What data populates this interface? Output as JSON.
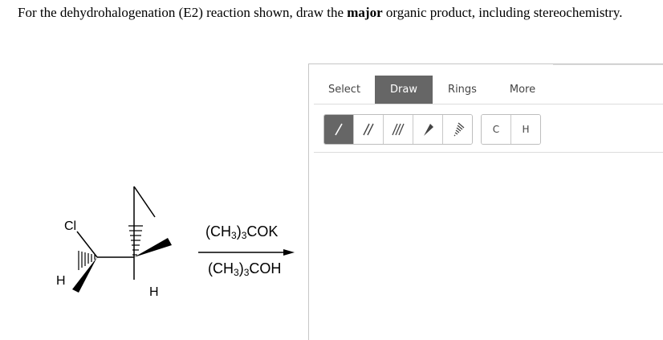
{
  "question": {
    "before": "For the dehydrohalogenation (E2) reaction shown, draw the ",
    "bold": "major",
    "after": " organic product, including stereochemistry."
  },
  "molecule": {
    "atoms": {
      "cl": "Cl",
      "h_left": "H",
      "h_bottom": "H"
    }
  },
  "reagents": {
    "top": {
      "a": "(CH",
      "b": "3",
      "c": ")",
      "d": "3",
      "e": "COK"
    },
    "bottom": {
      "a": "(CH",
      "b": "3",
      "c": ")",
      "d": "3",
      "e": "COH"
    }
  },
  "editor": {
    "tabs": [
      "Select",
      "Draw",
      "Rings",
      "More"
    ],
    "active_tab": "Draw",
    "bond_tools": [
      "single-bond",
      "double-bond",
      "triple-bond",
      "wedge-bond",
      "hash-bond"
    ],
    "active_tool": "single-bond",
    "atom_buttons": [
      "C",
      "H"
    ]
  }
}
